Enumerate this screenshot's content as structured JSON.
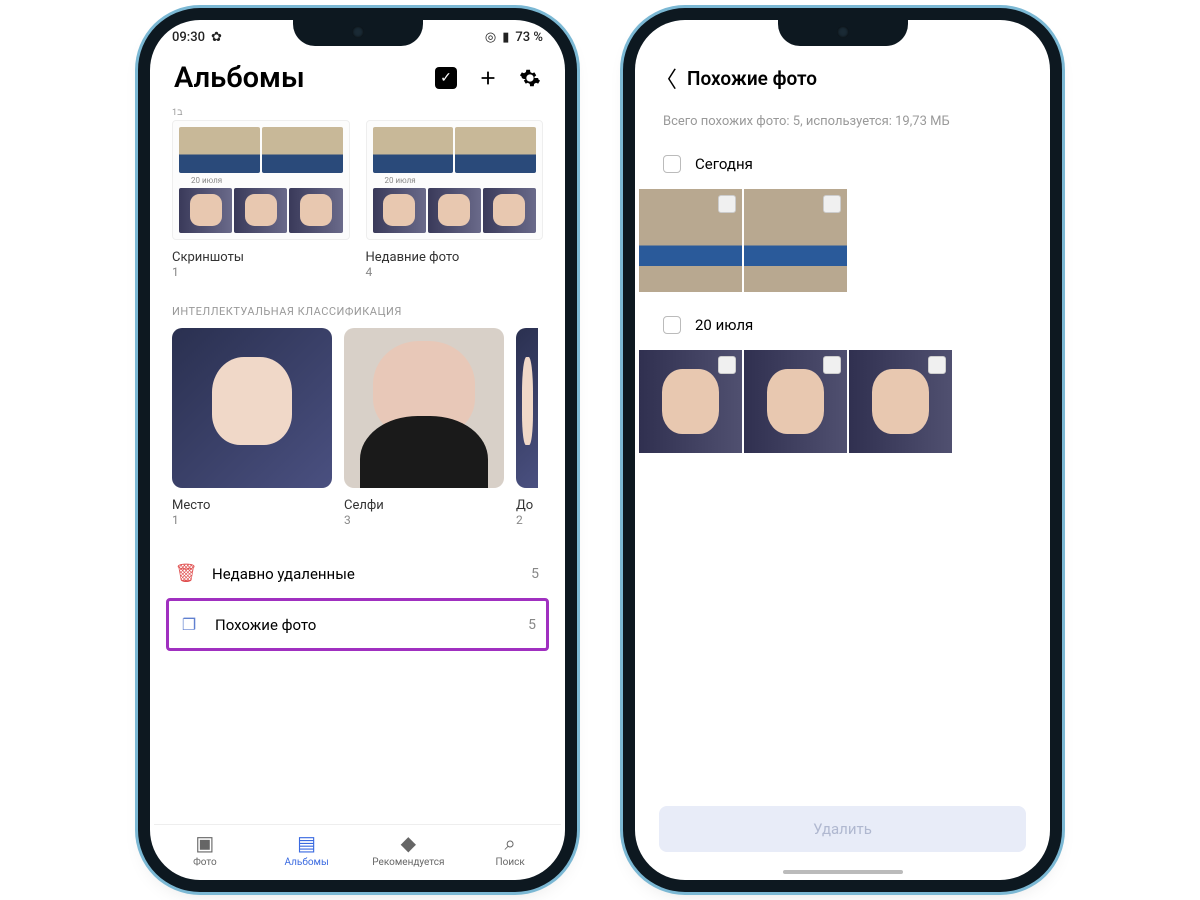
{
  "statusbar": {
    "time": "09:30",
    "battery": "73 %"
  },
  "phoneA": {
    "title": "Альбомы",
    "albums": [
      {
        "name": "Скриншоты",
        "count": "1",
        "innerDate": "20 июля"
      },
      {
        "name": "Недавние фото",
        "count": "4",
        "innerDate": "20 июля"
      }
    ],
    "smartSection": "ИНТЕЛЛЕКТУАЛЬНАЯ КЛАССИФИКАЦИЯ",
    "smart": [
      {
        "name": "Место",
        "count": "1"
      },
      {
        "name": "Селфи",
        "count": "3"
      },
      {
        "name": "До",
        "count": "2"
      }
    ],
    "listRows": [
      {
        "icon": "trash",
        "label": "Недавно удаленные",
        "count": "5"
      },
      {
        "icon": "copy",
        "label": "Похожие фото",
        "count": "5"
      }
    ],
    "nav": [
      {
        "label": "Фото"
      },
      {
        "label": "Альбомы"
      },
      {
        "label": "Рекомендуется"
      },
      {
        "label": "Поиск"
      }
    ]
  },
  "phoneB": {
    "title": "Похожие фото",
    "summary": "Всего похожих фото: 5, используется: 19,73 МБ",
    "groups": [
      {
        "date": "Сегодня",
        "photos": 2
      },
      {
        "date": "20 июля",
        "photos": 3
      }
    ],
    "deleteBtn": "Удалить"
  }
}
